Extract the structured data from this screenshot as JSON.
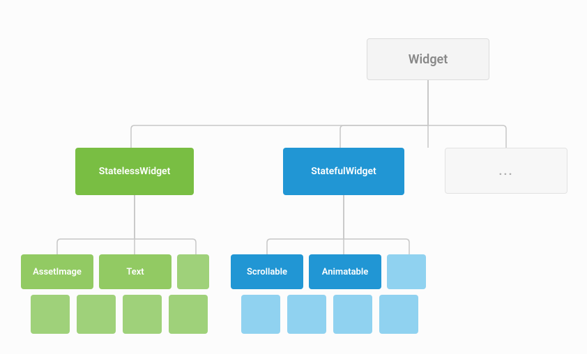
{
  "root": {
    "label": "Widget"
  },
  "ellipsis": {
    "label": "..."
  },
  "stateless": {
    "label": "StatelessWidget",
    "children": [
      {
        "label": "AssetImage"
      },
      {
        "label": "Text"
      }
    ]
  },
  "stateful": {
    "label": "StatefulWidget",
    "children": [
      {
        "label": "Scrollable"
      },
      {
        "label": "Animatable"
      }
    ]
  },
  "colors": {
    "green_main": "#79be43",
    "green_child": "#92ca63",
    "green_box": "#9fd17a",
    "blue_main": "#2196d4",
    "blue_box": "#90d2f0",
    "root_bg": "#f4f4f4",
    "connector": "#c7c7c7"
  }
}
